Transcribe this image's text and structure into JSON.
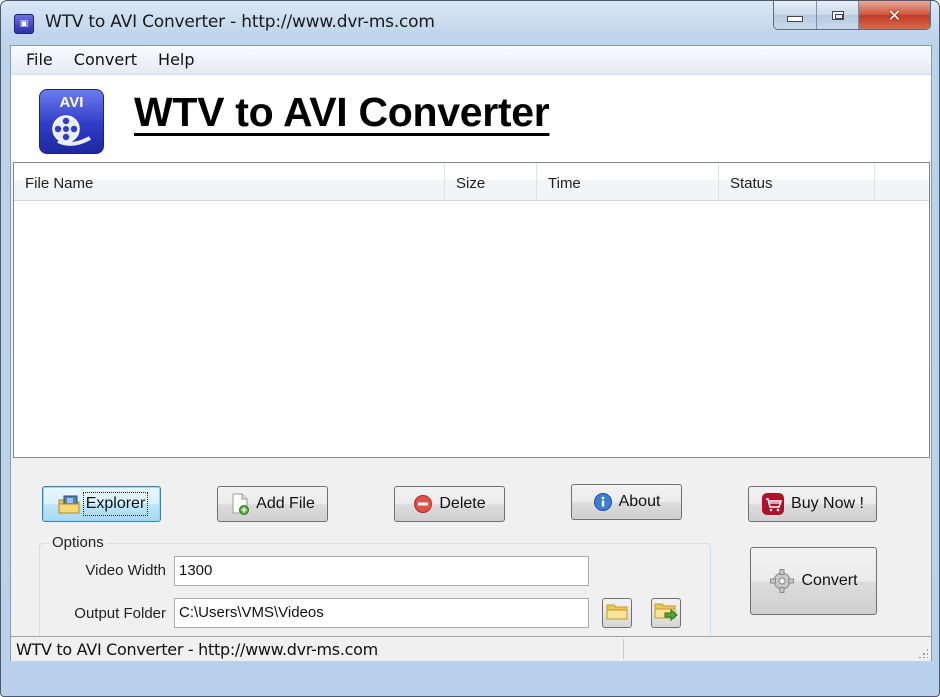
{
  "window": {
    "title": "WTV to AVI Converter - http://www.dvr-ms.com",
    "app_icon": "video-app-icon",
    "controls": {
      "minimize": "minimize-icon",
      "maximize": "maximize-icon",
      "close": "close-icon",
      "close_glyph": "✕"
    }
  },
  "menu": {
    "items": [
      {
        "label": "File"
      },
      {
        "label": "Convert"
      },
      {
        "label": "Help"
      }
    ]
  },
  "banner": {
    "logo_text": "AVI",
    "title": "WTV to AVI Converter"
  },
  "file_list": {
    "columns": [
      {
        "label": "File Name"
      },
      {
        "label": "Size"
      },
      {
        "label": "Time"
      },
      {
        "label": "Status"
      },
      {
        "label": ""
      }
    ],
    "rows": []
  },
  "buttons": {
    "explorer": {
      "label": "Explorer",
      "icon": "explorer-folder-icon"
    },
    "add_file": {
      "label": "Add File",
      "icon": "add-file-icon"
    },
    "delete": {
      "label": "Delete",
      "icon": "delete-icon"
    },
    "about": {
      "label": "About",
      "icon": "info-icon"
    },
    "buy_now": {
      "label": "Buy Now !",
      "icon": "cart-icon"
    },
    "convert": {
      "label": "Convert",
      "icon": "gear-icon"
    }
  },
  "options": {
    "legend": "Options",
    "video_width": {
      "label": "Video Width",
      "value": "1300"
    },
    "output_folder": {
      "label": "Output Folder",
      "value": "C:\\Users\\VMS\\Videos"
    },
    "browse_folder_icon": "folder-icon",
    "open_folder_icon": "open-folder-icon"
  },
  "colors": {
    "accent_blue": "#2f3cc7",
    "close_red": "#c23b22",
    "cart_red": "#b0102a",
    "focus_blue": "#3c7fb1"
  },
  "statusbar": {
    "text": "WTV to AVI Converter - http://www.dvr-ms.com"
  }
}
